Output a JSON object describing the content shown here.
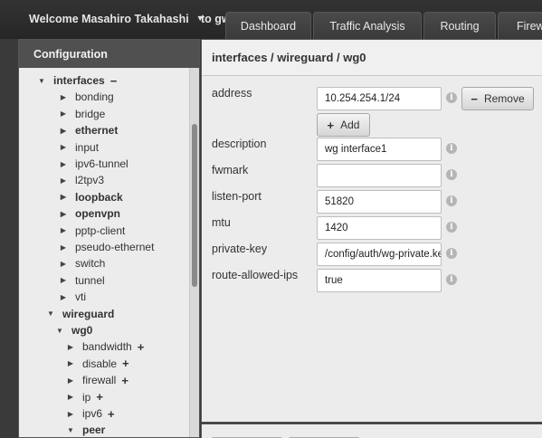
{
  "header": {
    "welcome": "Welcome Masahiro Takahashi",
    "to_text": "to gw",
    "tabs": [
      "Dashboard",
      "Traffic Analysis",
      "Routing",
      "Firew"
    ]
  },
  "sidebar": {
    "title": "Configuration",
    "tree": [
      {
        "label": "interfaces",
        "bold": true,
        "expanded": true,
        "indicator": "−"
      },
      {
        "label": "bonding"
      },
      {
        "label": "bridge"
      },
      {
        "label": "ethernet",
        "bold": true
      },
      {
        "label": "input"
      },
      {
        "label": "ipv6-tunnel"
      },
      {
        "label": "l2tpv3"
      },
      {
        "label": "loopback",
        "bold": true
      },
      {
        "label": "openvpn",
        "bold": true
      },
      {
        "label": "pptp-client"
      },
      {
        "label": "pseudo-ethernet"
      },
      {
        "label": "switch"
      },
      {
        "label": "tunnel"
      },
      {
        "label": "vti"
      },
      {
        "label": "wireguard",
        "bold": true,
        "expanded": true
      },
      {
        "label": "wg0",
        "bold": true,
        "expanded": true
      },
      {
        "label": "bandwidth",
        "indicator": "+"
      },
      {
        "label": "disable",
        "indicator": "+"
      },
      {
        "label": "firewall",
        "indicator": "+"
      },
      {
        "label": "ip",
        "indicator": "+"
      },
      {
        "label": "ipv6",
        "indicator": "+"
      },
      {
        "label": "peer",
        "bold": true,
        "expanded": true
      }
    ]
  },
  "main": {
    "breadcrumb": "interfaces / wireguard / wg0",
    "fields": [
      {
        "label": "address",
        "value": "10.254.254.1/24"
      },
      {
        "label": "description",
        "value": "wg interface1"
      },
      {
        "label": "fwmark",
        "value": ""
      },
      {
        "label": "listen-port",
        "value": "51820"
      },
      {
        "label": "mtu",
        "value": "1420"
      },
      {
        "label": "private-key",
        "value": "/config/auth/wg-private.ke"
      },
      {
        "label": "route-allowed-ips",
        "value": "true"
      }
    ],
    "remove_label": "Remove",
    "add_label": "Add",
    "info_glyph": "i"
  },
  "icons": {
    "caret": "caret-down-icon",
    "expanded": "triangle-down-icon",
    "collapsed": "triangle-right-icon",
    "plus": "plus-icon",
    "minus": "minus-icon",
    "info": "info-icon"
  },
  "colors": {
    "topbar": "#2c2c2c",
    "panel_bg": "#ececec",
    "panel_header": "#505050"
  }
}
